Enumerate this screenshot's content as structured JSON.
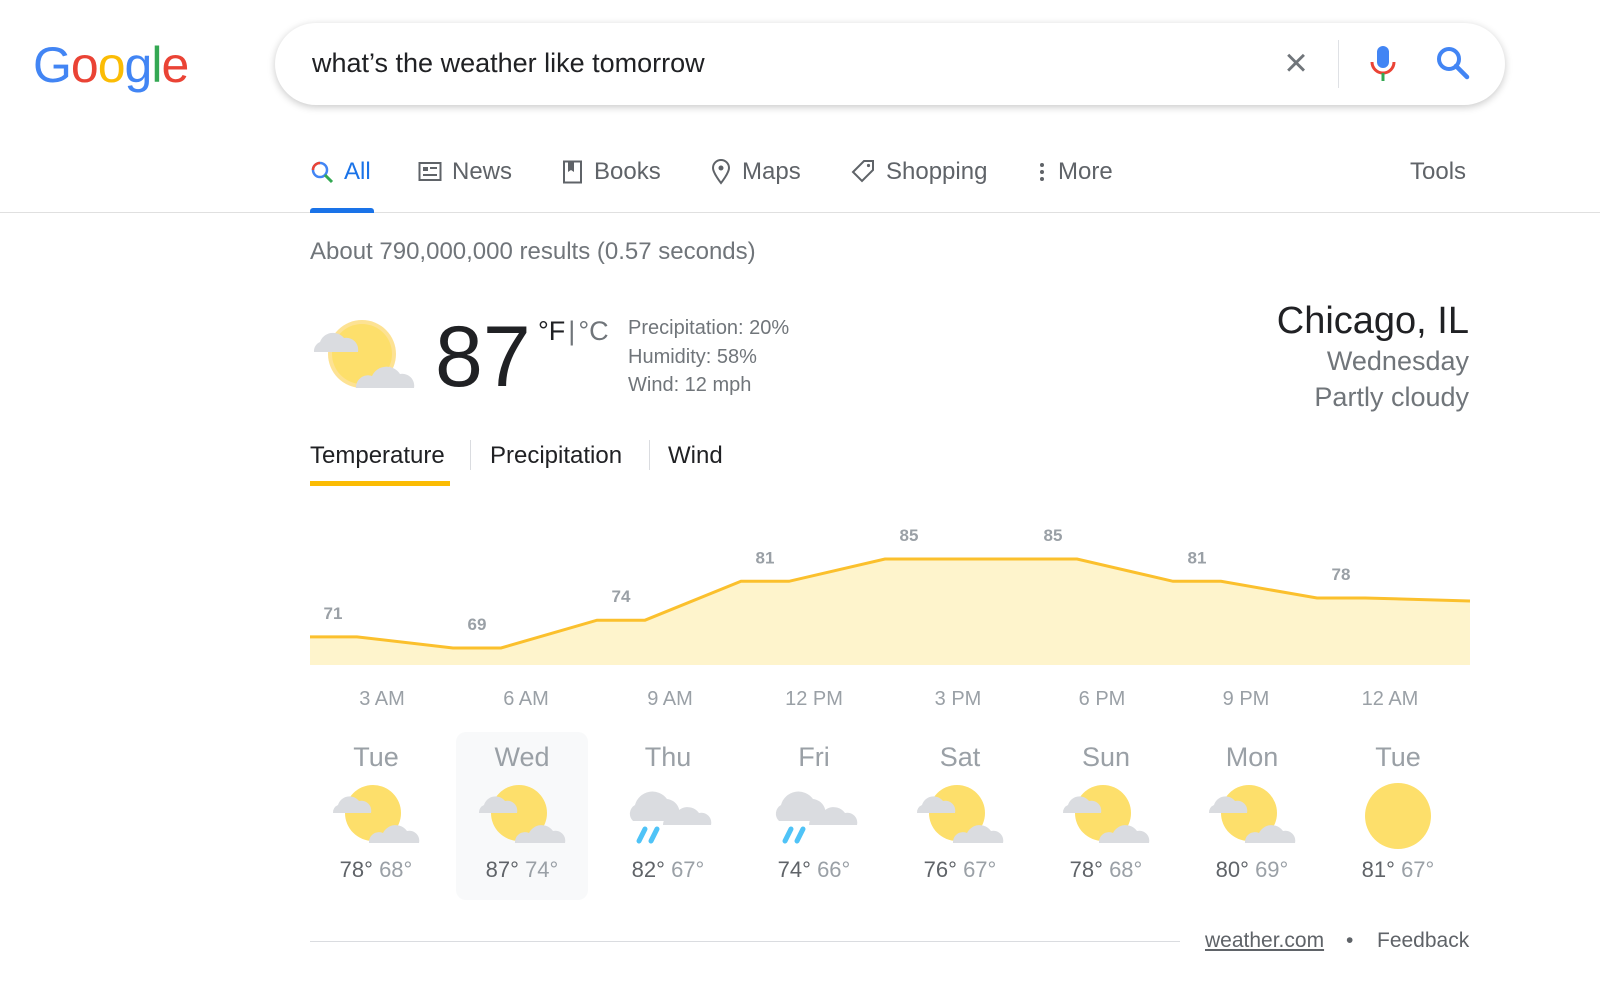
{
  "logo": "Google",
  "search": {
    "query": "what’s the weather like tomorrow"
  },
  "tabs": [
    {
      "label": "All",
      "icon": "search-icon"
    },
    {
      "label": "News",
      "icon": "news-icon"
    },
    {
      "label": "Books",
      "icon": "book-icon"
    },
    {
      "label": "Maps",
      "icon": "map-pin-icon"
    },
    {
      "label": "Shopping",
      "icon": "tag-icon"
    },
    {
      "label": "More",
      "icon": "more-vert-icon"
    }
  ],
  "tools": "Tools",
  "stats": "About 790,000,000 results (0.57 seconds)",
  "weather": {
    "temp": "87",
    "unit_f": "°F",
    "unit_sep": "|",
    "unit_c": "°C",
    "precip": "Precipitation: 20%",
    "humidity": "Humidity: 58%",
    "wind": "Wind: 12 mph",
    "city": "Chicago, IL",
    "day": "Wednesday",
    "condition": "Partly cloudy",
    "tabs": [
      "Temperature",
      "Precipitation",
      "Wind"
    ]
  },
  "chart_data": {
    "type": "area",
    "x": [
      "3 AM",
      "6 AM",
      "9 AM",
      "12 PM",
      "3 PM",
      "6 PM",
      "9 PM",
      "12 AM"
    ],
    "values": [
      71,
      69,
      74,
      81,
      85,
      85,
      81,
      78
    ],
    "line_color": "#fbc02d",
    "fill_color": "#fef4cc"
  },
  "days": [
    {
      "name": "Tue",
      "icon": "partly-cloudy",
      "hi": "78°",
      "lo": "68°"
    },
    {
      "name": "Wed",
      "icon": "partly-cloudy",
      "hi": "87°",
      "lo": "74°",
      "selected": true
    },
    {
      "name": "Thu",
      "icon": "rain",
      "hi": "82°",
      "lo": "67°"
    },
    {
      "name": "Fri",
      "icon": "rain",
      "hi": "74°",
      "lo": "66°"
    },
    {
      "name": "Sat",
      "icon": "partly-cloudy",
      "hi": "76°",
      "lo": "67°"
    },
    {
      "name": "Sun",
      "icon": "partly-cloudy",
      "hi": "78°",
      "lo": "68°"
    },
    {
      "name": "Mon",
      "icon": "partly-cloudy",
      "hi": "80°",
      "lo": "69°"
    },
    {
      "name": "Tue",
      "icon": "sunny",
      "hi": "81°",
      "lo": "67°"
    }
  ],
  "footer": {
    "source": "weather.com",
    "sep": "•",
    "feedback": "Feedback"
  }
}
